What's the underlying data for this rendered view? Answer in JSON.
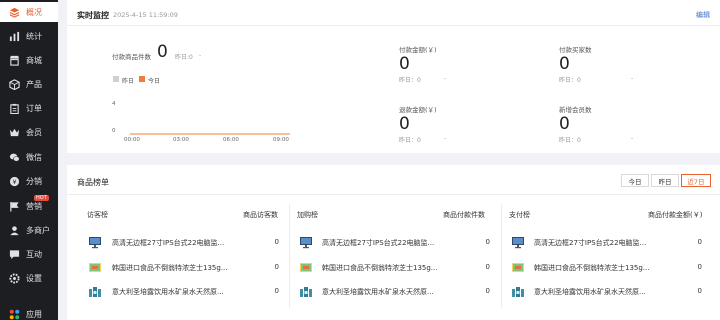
{
  "sidebar": {
    "items": [
      {
        "label": "概况",
        "icon": "layers-icon",
        "active": true
      },
      {
        "label": "统计",
        "icon": "bar-chart-icon"
      },
      {
        "label": "商城",
        "icon": "store-icon"
      },
      {
        "label": "产品",
        "icon": "box-icon"
      },
      {
        "label": "订单",
        "icon": "clipboard-icon"
      },
      {
        "label": "会员",
        "icon": "crown-icon"
      },
      {
        "label": "微信",
        "icon": "wechat-icon"
      },
      {
        "label": "分销",
        "icon": "distribution-icon"
      },
      {
        "label": "营销",
        "icon": "flag-icon",
        "badge": "HOT"
      },
      {
        "label": "多商户",
        "icon": "merchant-icon"
      },
      {
        "label": "互动",
        "icon": "chat-icon"
      },
      {
        "label": "设置",
        "icon": "settings-icon"
      },
      {
        "label": "应用",
        "icon": "apps-icon"
      }
    ]
  },
  "monitor": {
    "title": "实时监控",
    "timestamp": "2025-4-15 11:59:09",
    "edit_label": "编辑",
    "paid_items_label": "付款商品件数",
    "paid_items_value": "0",
    "yesterday_label": "昨日:0",
    "yesterday_dash": "-",
    "legend_yesterday": "昨日",
    "legend_today": "今日",
    "y_ticks": [
      "4",
      "0"
    ],
    "x_ticks": [
      "00:00",
      "03:00",
      "06:00",
      "09:00"
    ],
    "metrics": [
      {
        "label": "付款金额(￥)",
        "value": "0",
        "yesterday": "昨日：0",
        "dash": "-"
      },
      {
        "label": "付款买家数",
        "value": "0",
        "yesterday": "昨日：0",
        "dash": "-"
      },
      {
        "label": "退款金额(￥)",
        "value": "0",
        "yesterday": "昨日：0",
        "dash": "-"
      },
      {
        "label": "新增会员数",
        "value": "0",
        "yesterday": "昨日：0",
        "dash": "-"
      }
    ]
  },
  "ranking": {
    "title": "商品榜单",
    "ranges": [
      "今日",
      "昨日",
      "近7日"
    ],
    "selected_range": "近7日",
    "columns": [
      {
        "title": "访客榜",
        "metric": "商品访客数"
      },
      {
        "title": "加购榜",
        "metric": "商品付款件数"
      },
      {
        "title": "支付榜",
        "metric": "商品付款金额(￥)"
      }
    ],
    "products": [
      {
        "name": "高清无边框27寸IPS台式22电脑监...",
        "thumb": "monitor"
      },
      {
        "name": "韩国进口食品不倒翁特浓芝士135g...",
        "thumb": "snack"
      },
      {
        "name": "意大利圣培露饮用水矿泉水天然原...",
        "thumb": "water"
      }
    ],
    "values": [
      [
        "0",
        "0",
        "0"
      ],
      [
        "0",
        "0",
        "0"
      ],
      [
        "0",
        "0",
        "0"
      ]
    ]
  },
  "chart_data": {
    "type": "line",
    "x": [
      "00:00",
      "03:00",
      "06:00",
      "09:00"
    ],
    "ylim": [
      0,
      4
    ],
    "legend": [
      "昨日",
      "今日"
    ],
    "series": [
      {
        "name": "昨日",
        "values": [
          0,
          0,
          0,
          0
        ]
      },
      {
        "name": "今日",
        "values": [
          0,
          0,
          0,
          0
        ]
      }
    ],
    "colors": {
      "昨日": "#d0d0d0",
      "今日": "#f07c3c"
    }
  }
}
